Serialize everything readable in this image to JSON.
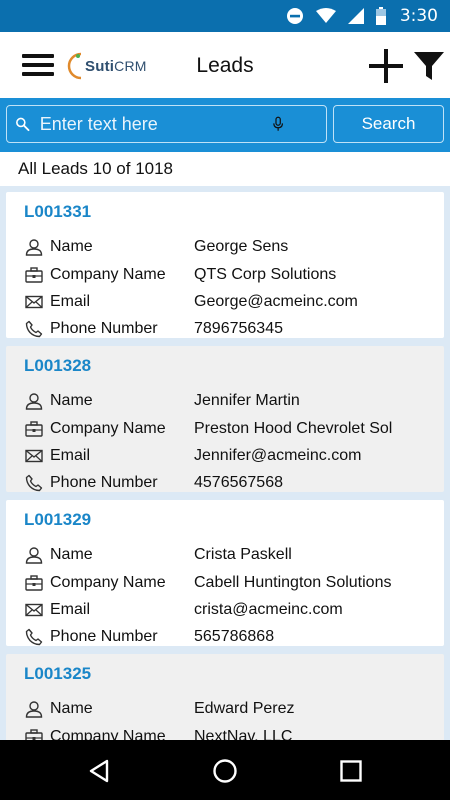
{
  "status_bar": {
    "time": "3:30",
    "icons": [
      "do-not-disturb-icon",
      "wifi-icon",
      "signal-icon",
      "battery-icon"
    ]
  },
  "app_bar": {
    "logo_text": "Suti",
    "logo_suffix": "CRM",
    "title": "Leads",
    "icons": [
      "menu-icon",
      "add-icon",
      "filter-icon"
    ]
  },
  "search": {
    "placeholder": "Enter text here",
    "value": "",
    "button_label": "Search"
  },
  "list_header": {
    "label": "All Leads 10 of 1018"
  },
  "field_labels": {
    "name": "Name",
    "company": "Company Name",
    "email": "Email",
    "phone": "Phone Number"
  },
  "leads": [
    {
      "id": "L001331",
      "name": "George Sens",
      "company": "QTS Corp Solutions",
      "email": "George@acmeinc.com",
      "phone": "7896756345"
    },
    {
      "id": "L001328",
      "name": "Jennifer Martin",
      "company": "Preston Hood Chevrolet Sol",
      "email": "Jennifer@acmeinc.com",
      "phone": "4576567568"
    },
    {
      "id": "L001329",
      "name": "Crista Paskell",
      "company": "Cabell Huntington Solutions",
      "email": "crista@acmeinc.com",
      "phone": "565786868"
    },
    {
      "id": "L001325",
      "name": "Edward Perez",
      "company": "NextNav, LLC",
      "email": "",
      "phone": ""
    }
  ],
  "colors": {
    "primary": "#1a8fd6",
    "status_bar": "#0b6fae",
    "lead_id": "#1a86c8",
    "list_bg": "#dce9f5"
  },
  "nav_bar": {
    "icons": [
      "back-icon",
      "home-icon",
      "recents-icon"
    ]
  }
}
